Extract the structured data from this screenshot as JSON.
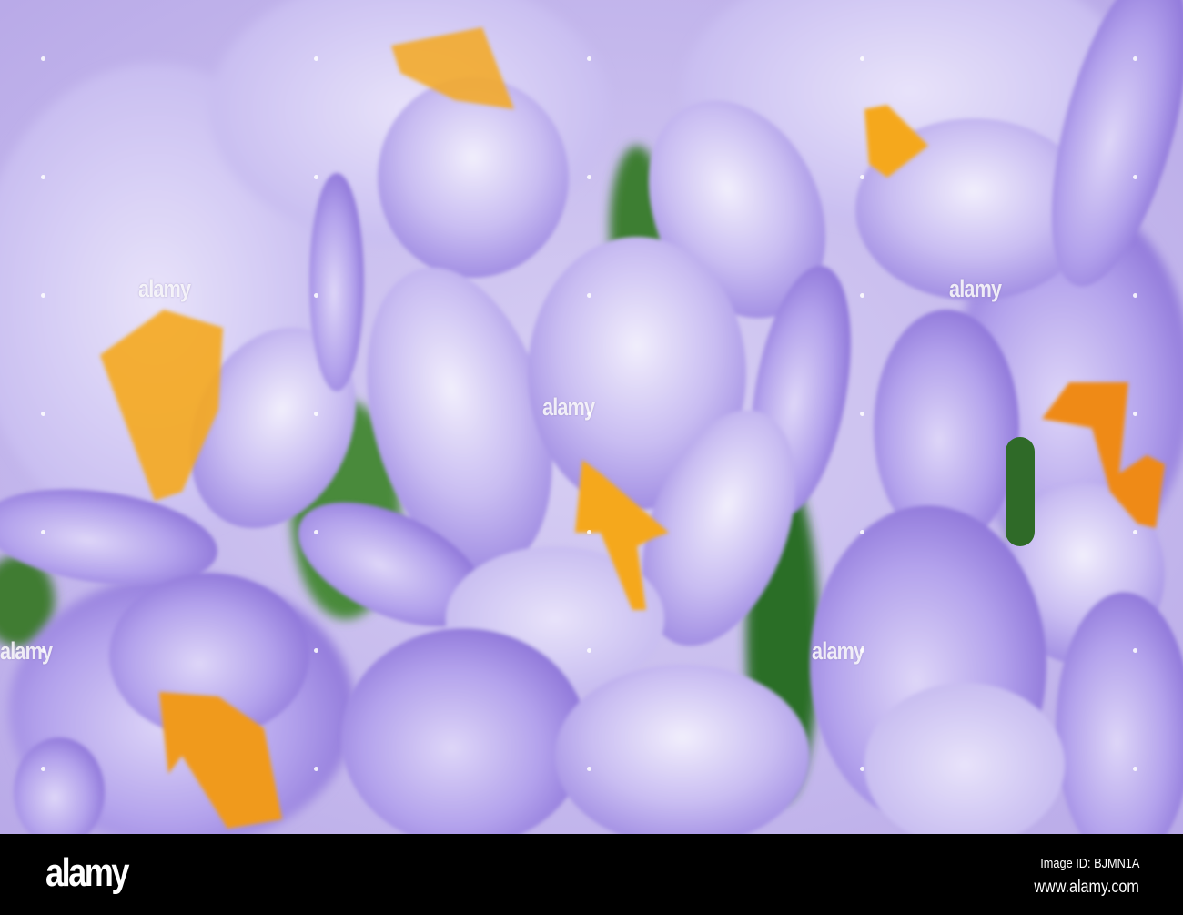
{
  "photo": {
    "subject": "crocus flowers",
    "colors": {
      "petal": "#b7a6ee",
      "petal_light": "#ece8fb",
      "petal_dark": "#8d75dc",
      "stamen": "#f5a81c",
      "leaf": "#2f7a2a"
    },
    "watermark": "alamy"
  },
  "footer": {
    "logo": "alamy",
    "image_id": "Image ID: BJMN1A",
    "website": "www.alamy.com"
  }
}
